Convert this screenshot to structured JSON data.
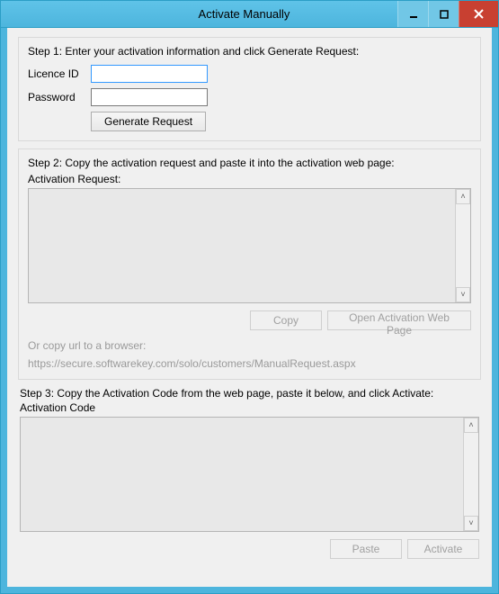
{
  "window": {
    "title": "Activate Manually"
  },
  "step1": {
    "heading": "Step 1: Enter your activation information and click Generate Request:",
    "licence_label": "Licence ID",
    "licence_value": "",
    "password_label": "Password",
    "password_value": "",
    "generate_label": "Generate Request"
  },
  "step2": {
    "heading": "Step 2: Copy the activation request and paste it into the activation web page:",
    "request_label": "Activation Request:",
    "request_value": "",
    "copy_label": "Copy",
    "open_label": "Open Activation Web Page",
    "url_hint": "Or copy url to a browser:",
    "url_text": "https://secure.softwarekey.com/solo/customers/ManualRequest.aspx"
  },
  "step3": {
    "heading": "Step 3: Copy the Activation Code from the web page, paste it below, and click Activate:",
    "code_label": "Activation Code",
    "code_value": "",
    "paste_label": "Paste",
    "activate_label": "Activate"
  }
}
